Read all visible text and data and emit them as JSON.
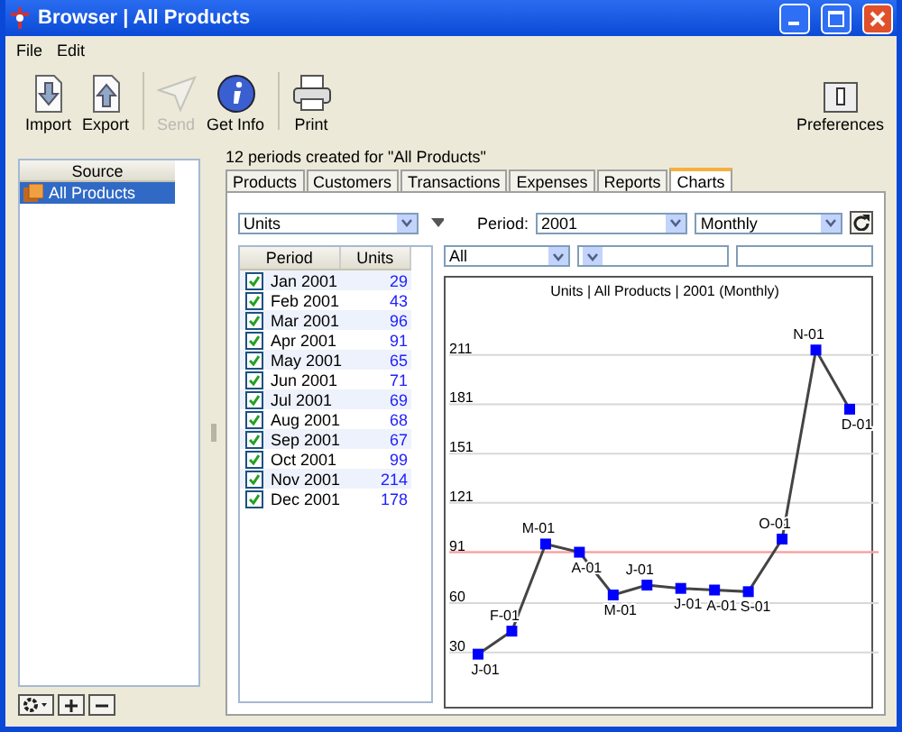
{
  "window": {
    "title": "Browser | All Products"
  },
  "menu": [
    "File",
    "Edit"
  ],
  "toolbar": [
    {
      "label": "Import",
      "kind": "import",
      "disabled": false
    },
    {
      "label": "Export",
      "kind": "export",
      "disabled": false
    },
    {
      "label": "Send",
      "kind": "send",
      "disabled": true
    },
    {
      "label": "Get Info",
      "kind": "info",
      "disabled": false
    },
    {
      "label": "Print",
      "kind": "print",
      "disabled": false
    }
  ],
  "preferences": {
    "label": "Preferences"
  },
  "source": {
    "header": "Source",
    "items": [
      {
        "label": "All Products",
        "selected": true
      }
    ]
  },
  "status_text": "12 periods created for \"All Products\"",
  "tabs": [
    {
      "label": "Products",
      "selected": false
    },
    {
      "label": "Customers",
      "selected": false
    },
    {
      "label": "Transactions",
      "selected": false
    },
    {
      "label": "Expenses",
      "selected": false
    },
    {
      "label": "Reports",
      "selected": false
    },
    {
      "label": "Charts",
      "selected": true
    }
  ],
  "controls": {
    "measure": "Units",
    "period_label": "Period:",
    "year": "2001",
    "interval": "Monthly",
    "filter": "All"
  },
  "table": {
    "columns": [
      "Period",
      "Units"
    ],
    "rows": [
      {
        "period": "Jan 2001",
        "units": "29",
        "checked": true
      },
      {
        "period": "Feb 2001",
        "units": "43",
        "checked": true
      },
      {
        "period": "Mar 2001",
        "units": "96",
        "checked": true
      },
      {
        "period": "Apr 2001",
        "units": "91",
        "checked": true
      },
      {
        "period": "May 2001",
        "units": "65",
        "checked": true
      },
      {
        "period": "Jun 2001",
        "units": "71",
        "checked": true
      },
      {
        "period": "Jul 2001",
        "units": "69",
        "checked": true
      },
      {
        "period": "Aug 2001",
        "units": "68",
        "checked": true
      },
      {
        "period": "Sep 2001",
        "units": "67",
        "checked": true
      },
      {
        "period": "Oct 2001",
        "units": "99",
        "checked": true
      },
      {
        "period": "Nov 2001",
        "units": "214",
        "checked": true
      },
      {
        "period": "Dec 2001",
        "units": "178",
        "checked": true
      }
    ]
  },
  "chart_data": {
    "type": "line",
    "title": "Units | All Products | 2001 (Monthly)",
    "categories": [
      "J-01",
      "F-01",
      "M-01",
      "A-01",
      "M-01",
      "J-01",
      "J-01",
      "A-01",
      "S-01",
      "O-01",
      "N-01",
      "D-01"
    ],
    "series": [
      {
        "color": "#0000ff",
        "marker": "square",
        "values": [
          29,
          43,
          96,
          91,
          65,
          71,
          69,
          68,
          67,
          99,
          214,
          178
        ]
      }
    ],
    "ylim": [
      -3,
      258
    ],
    "yticks": [
      30,
      60,
      91,
      121,
      151,
      181,
      211
    ],
    "grid": true,
    "ref_lines": [
      {
        "axis": "y",
        "value": 91,
        "color": "#ff9999"
      }
    ]
  }
}
